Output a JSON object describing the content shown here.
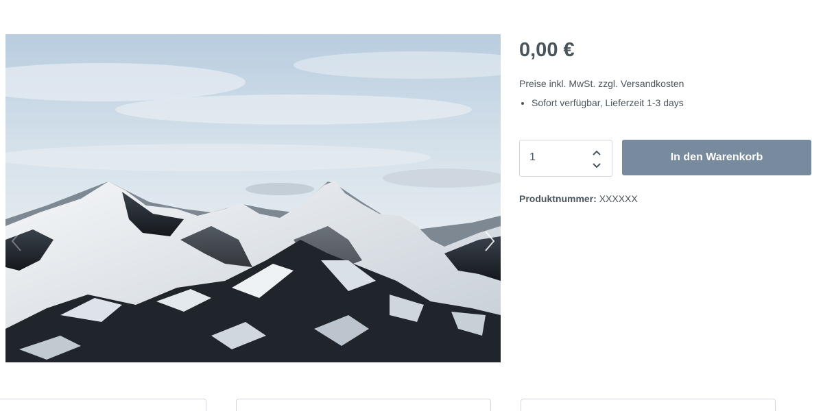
{
  "product": {
    "price": "0,00 €",
    "tax_note": "Preise inkl. MwSt. zzgl. Versandkosten",
    "delivery_items": [
      "Sofort verfügbar, Lieferzeit 1-3 days"
    ],
    "quantity": "1",
    "cart_button_label": "In den Warenkorb",
    "product_number_label": "Produktnummer:",
    "product_number_value": "XXXXXX"
  },
  "colors": {
    "text": "#4a545b",
    "button": "#778a9e",
    "border": "#d1d7dc"
  },
  "gallery": {
    "image_subject": "snow-covered mountain range under cloudy sky",
    "prev_icon": "chevron-left-icon",
    "next_icon": "chevron-right-icon"
  }
}
